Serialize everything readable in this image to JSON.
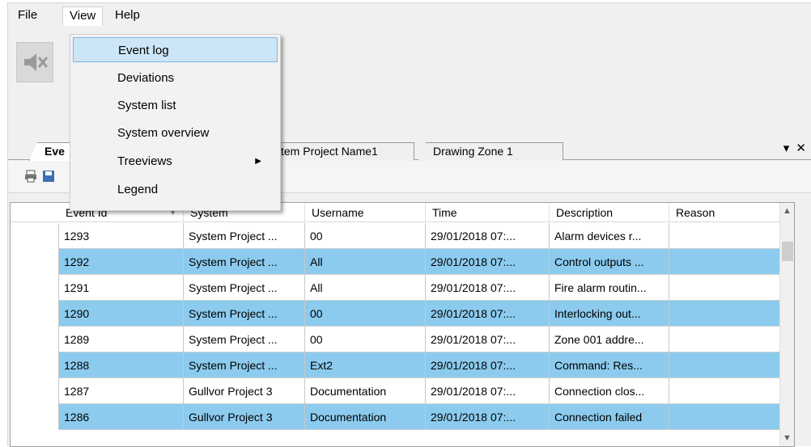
{
  "menubar": {
    "file": "File",
    "view": "View",
    "help": "Help"
  },
  "view_menu": {
    "items": [
      {
        "label": "Event log"
      },
      {
        "label": "Deviations"
      },
      {
        "label": "System list"
      },
      {
        "label": "System overview"
      },
      {
        "label": "Treeviews"
      },
      {
        "label": "Legend"
      }
    ]
  },
  "tabs": [
    {
      "label": "Eve"
    },
    {
      "label": "ystem Project Name1"
    },
    {
      "label": "Drawing Zone 1"
    }
  ],
  "tab_controls": {
    "dropdown": "▾",
    "close": "✕"
  },
  "grid": {
    "columns": [
      "Event Id",
      "System",
      "Username",
      "Time",
      "Description",
      "Reason"
    ],
    "rows": [
      [
        "1293",
        "System Project ...",
        "00",
        "29/01/2018 07:...",
        "Alarm devices r...",
        ""
      ],
      [
        "1292",
        "System Project ...",
        "All",
        "29/01/2018 07:...",
        "Control outputs ...",
        ""
      ],
      [
        "1291",
        "System Project ...",
        "All",
        "29/01/2018 07:...",
        "Fire alarm routin...",
        ""
      ],
      [
        "1290",
        "System Project ...",
        "00",
        "29/01/2018 07:...",
        "Interlocking out...",
        ""
      ],
      [
        "1289",
        "System Project ...",
        "00",
        "29/01/2018 07:...",
        "Zone 001 addre...",
        ""
      ],
      [
        "1288",
        "System Project ...",
        "Ext2",
        "29/01/2018 07:...",
        "Command: Res...",
        ""
      ],
      [
        "1287",
        "Gullvor Project 3",
        "Documentation",
        "29/01/2018 07:...",
        "Connection clos...",
        ""
      ],
      [
        "1286",
        "Gullvor Project 3",
        "Documentation",
        "29/01/2018 07:...",
        "Connection failed",
        ""
      ]
    ]
  },
  "colors": {
    "row_alt": "#8ccbee",
    "menu_highlight": "#cde6f7"
  },
  "icons": {
    "mute": "speaker-muted-icon",
    "print": "printer-icon",
    "save": "save-icon"
  }
}
